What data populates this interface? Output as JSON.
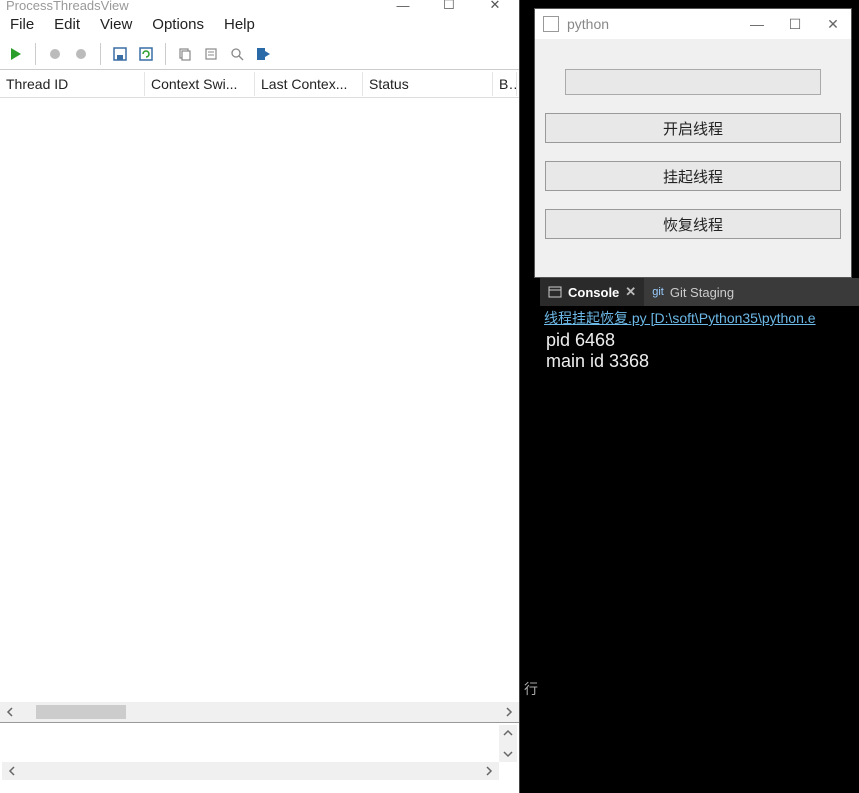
{
  "ptv": {
    "title": "ProcessThreadsView",
    "menu": {
      "file": "File",
      "edit": "Edit",
      "view": "View",
      "options": "Options",
      "help": "Help"
    },
    "columns": {
      "thread_id": "Thread ID",
      "context_swi": "Context Swi...",
      "last_contex": "Last Contex...",
      "status": "Status",
      "ba": "Ba"
    }
  },
  "py": {
    "title": "python",
    "buttons": {
      "start": "开启线程",
      "suspend": "挂起线程",
      "resume": "恢复线程"
    }
  },
  "ide": {
    "tabs": {
      "console": "Console",
      "git_staging": "Git Staging"
    },
    "link": "线程挂起恢复.py [D:\\soft\\Python35\\python.e"
  },
  "console": {
    "line1": "pid 6468",
    "line2": "main id 3368"
  },
  "stray": {
    "xing": "行"
  }
}
